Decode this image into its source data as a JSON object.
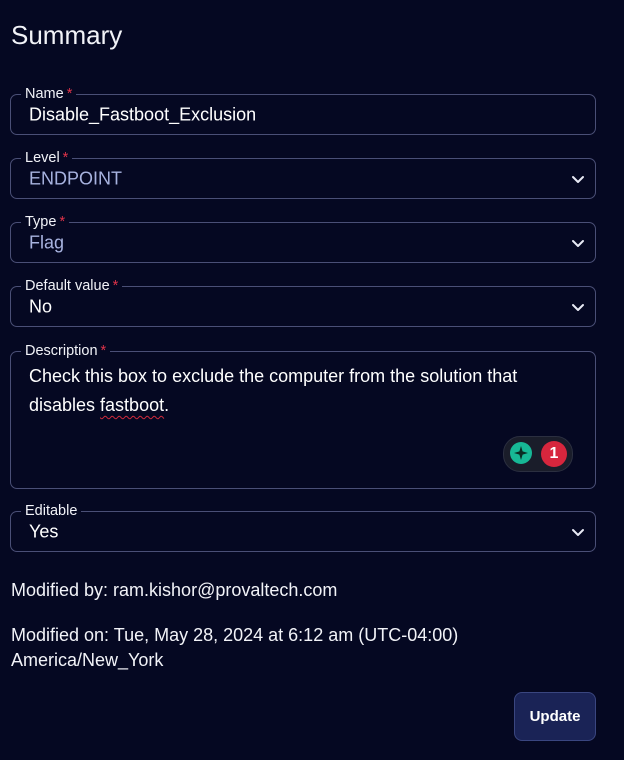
{
  "title": "Summary",
  "required_mark": "*",
  "fields": {
    "name": {
      "label": "Name",
      "value": "Disable_Fastboot_Exclusion"
    },
    "level": {
      "label": "Level",
      "value": "ENDPOINT"
    },
    "type": {
      "label": "Type",
      "value": "Flag"
    },
    "default_value": {
      "label": "Default value",
      "value": "No"
    },
    "description": {
      "label": "Description",
      "value_before": "Check this box to exclude the computer from the solution that disables ",
      "value_flagged": "fastboot",
      "value_after": "."
    },
    "editable": {
      "label": "Editable",
      "value": "Yes"
    }
  },
  "grammar_widget": {
    "count": "1"
  },
  "modified_by": "Modified by: ram.kishor@provaltech.com",
  "modified_on_line1": "Modified on: Tue, May 28, 2024 at 6:12 am (UTC-04:00)",
  "modified_on_line2": "America/New_York",
  "update_button": "Update",
  "colors": {
    "background": "#050822",
    "border": "#4a4f76",
    "required": "#e0334a",
    "button_bg": "#1a2356"
  }
}
